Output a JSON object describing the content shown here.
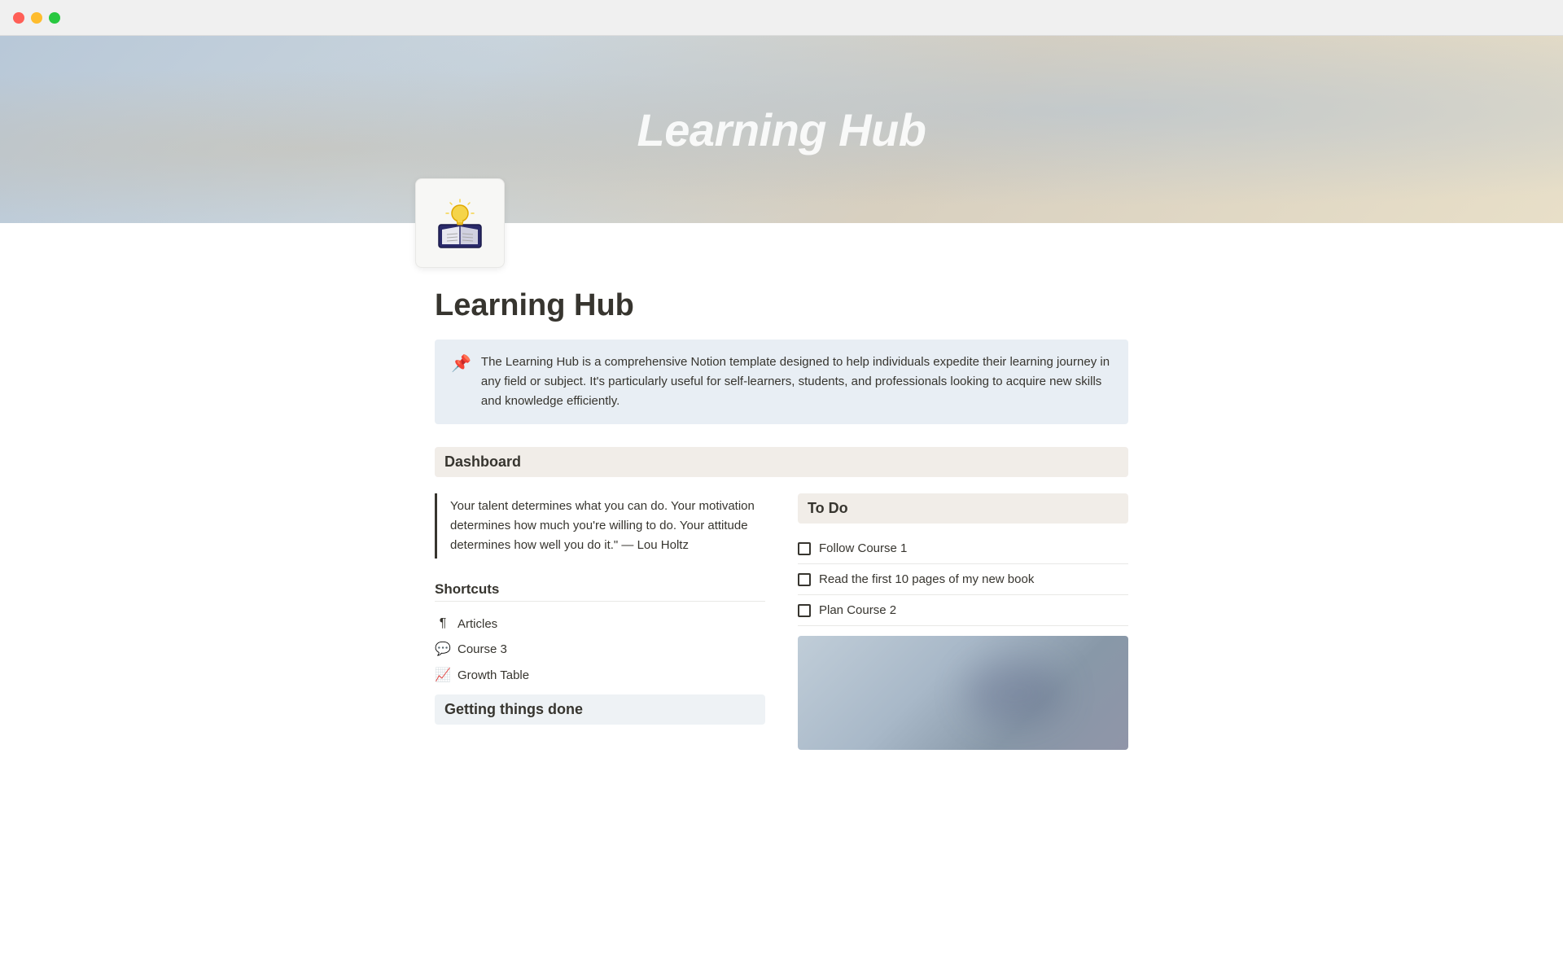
{
  "titlebar": {
    "buttons": [
      "close",
      "minimize",
      "maximize"
    ]
  },
  "hero": {
    "title": "Learning Hub"
  },
  "page": {
    "icon": "📖",
    "title": "Learning Hub"
  },
  "callout": {
    "icon": "📌",
    "text": "The Learning Hub is a comprehensive Notion template designed to help individuals expedite their learning journey in any field or subject. It's particularly useful for self-learners, students, and professionals looking to acquire new skills and knowledge efficiently."
  },
  "dashboard": {
    "section_title": "Dashboard",
    "quote": "Your talent determines what you can do. Your motivation determines how much you're willing to do. Your attitude determines how well you do it.\" — Lou Holtz",
    "shortcuts": {
      "title": "Shortcuts",
      "items": [
        {
          "icon": "¶",
          "label": "Articles"
        },
        {
          "icon": "💬",
          "label": "Course 3"
        },
        {
          "icon": "📈",
          "label": "Growth Table"
        }
      ]
    },
    "getting_things_done": "Getting things done"
  },
  "todo": {
    "title": "To Do",
    "items": [
      {
        "label": "Follow Course 1",
        "checked": false
      },
      {
        "label": "Read the first 10 pages of my new book",
        "checked": false
      },
      {
        "label": "Plan Course 2",
        "checked": false
      }
    ]
  }
}
